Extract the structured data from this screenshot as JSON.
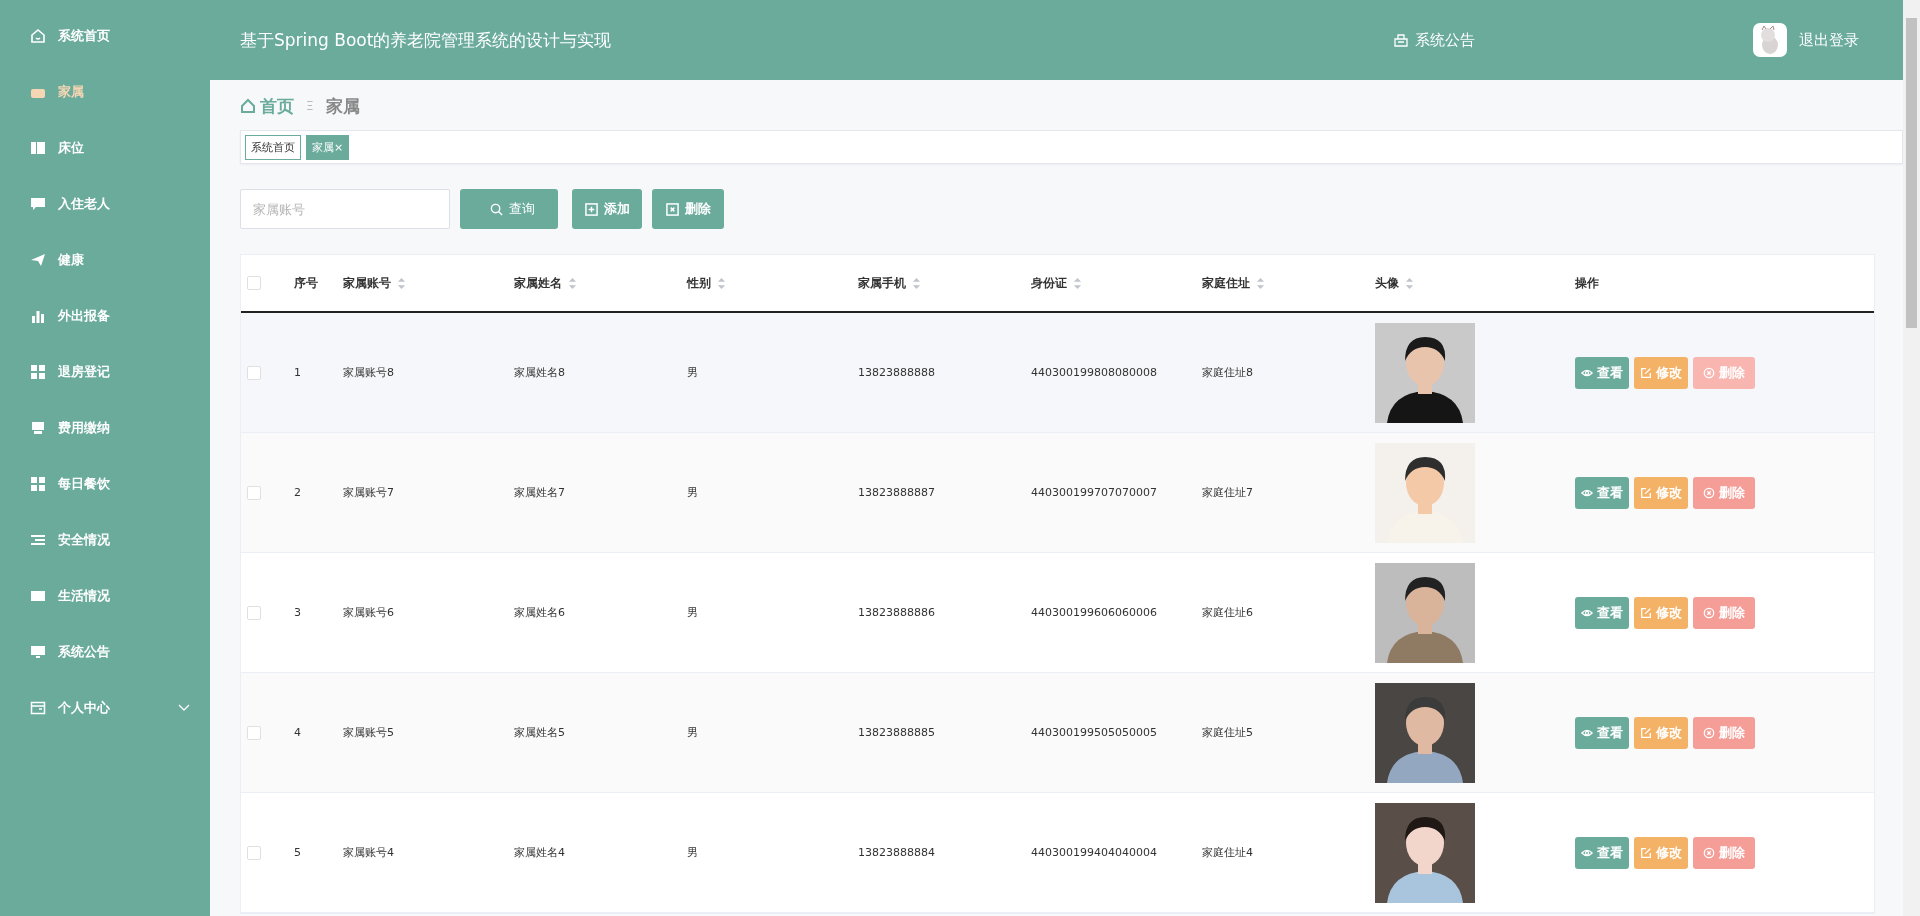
{
  "header": {
    "title": "基于Spring Boot的养老院管理系统的设计与实现",
    "notice": "系统公告",
    "logout": "退出登录"
  },
  "sidebar": {
    "items": [
      {
        "label": "系统首页",
        "selected": false,
        "kind": "link"
      },
      {
        "label": "家属",
        "selected": true,
        "kind": "link"
      },
      {
        "label": "床位",
        "selected": false,
        "kind": "link"
      },
      {
        "label": "入住老人",
        "selected": false,
        "kind": "link"
      },
      {
        "label": "健康",
        "selected": false,
        "kind": "link"
      },
      {
        "label": "外出报备",
        "selected": false,
        "kind": "link"
      },
      {
        "label": "退房登记",
        "selected": false,
        "kind": "link"
      },
      {
        "label": "费用缴纳",
        "selected": false,
        "kind": "link"
      },
      {
        "label": "每日餐饮",
        "selected": false,
        "kind": "link"
      },
      {
        "label": "安全情况",
        "selected": false,
        "kind": "link"
      },
      {
        "label": "生活情况",
        "selected": false,
        "kind": "link"
      },
      {
        "label": "系统公告",
        "selected": false,
        "kind": "link"
      },
      {
        "label": "个人中心",
        "selected": false,
        "kind": "submenu"
      }
    ]
  },
  "breadcrumb": {
    "home": "首页",
    "separator": "Ξ",
    "current": "家属"
  },
  "tags": [
    {
      "label": "系统首页",
      "selected": false
    },
    {
      "label": "家属",
      "selected": true,
      "close": "×"
    }
  ],
  "toolbar": {
    "search": {
      "placeholder": "家属账号"
    },
    "buttons": [
      {
        "label": "查询",
        "kind": "search"
      },
      {
        "label": "添加",
        "kind": "add"
      },
      {
        "label": "删除",
        "kind": "delete"
      }
    ]
  },
  "table": {
    "all_checked": false,
    "columns": [
      {
        "label": "序号",
        "kind": "plain"
      },
      {
        "label": "家属账号",
        "kind": "sortable"
      },
      {
        "label": "家属姓名",
        "kind": "sortable"
      },
      {
        "label": "性别",
        "kind": "sortable"
      },
      {
        "label": "家属手机",
        "kind": "sortable"
      },
      {
        "label": "身份证",
        "kind": "sortable"
      },
      {
        "label": "家庭住址",
        "kind": "sortable"
      },
      {
        "label": "头像",
        "kind": "sortable"
      },
      {
        "label": "操作",
        "kind": "plain"
      }
    ],
    "rows": [
      {
        "cells": [
          "1",
          "家属账号8",
          "家属姓名8",
          "男",
          "13823888888",
          "440300199808080008",
          "家庭住址8"
        ],
        "checked": false,
        "hovered": true,
        "actions": [
          {
            "label": "查看",
            "kind": "view"
          },
          {
            "label": "修改",
            "kind": "edit"
          },
          {
            "label": "删除",
            "kind": "delete"
          }
        ]
      },
      {
        "cells": [
          "2",
          "家属账号7",
          "家属姓名7",
          "男",
          "13823888887",
          "440300199707070007",
          "家庭住址7"
        ],
        "checked": false,
        "hovered": false,
        "actions": [
          {
            "label": "查看",
            "kind": "view"
          },
          {
            "label": "修改",
            "kind": "edit"
          },
          {
            "label": "删除",
            "kind": "delete"
          }
        ]
      },
      {
        "cells": [
          "3",
          "家属账号6",
          "家属姓名6",
          "男",
          "13823888886",
          "440300199606060006",
          "家庭住址6"
        ],
        "checked": false,
        "hovered": false,
        "actions": [
          {
            "label": "查看",
            "kind": "view"
          },
          {
            "label": "修改",
            "kind": "edit"
          },
          {
            "label": "删除",
            "kind": "delete"
          }
        ]
      },
      {
        "cells": [
          "4",
          "家属账号5",
          "家属姓名5",
          "男",
          "13823888885",
          "440300199505050005",
          "家庭住址5"
        ],
        "checked": false,
        "hovered": false,
        "actions": [
          {
            "label": "查看",
            "kind": "view"
          },
          {
            "label": "修改",
            "kind": "edit"
          },
          {
            "label": "删除",
            "kind": "delete"
          }
        ]
      },
      {
        "cells": [
          "5",
          "家属账号4",
          "家属姓名4",
          "男",
          "13823888884",
          "440300199404040004",
          "家庭住址4"
        ],
        "checked": false,
        "hovered": false,
        "actions": [
          {
            "label": "查看",
            "kind": "view"
          },
          {
            "label": "修改",
            "kind": "edit"
          },
          {
            "label": "删除",
            "kind": "delete"
          }
        ]
      }
    ]
  }
}
